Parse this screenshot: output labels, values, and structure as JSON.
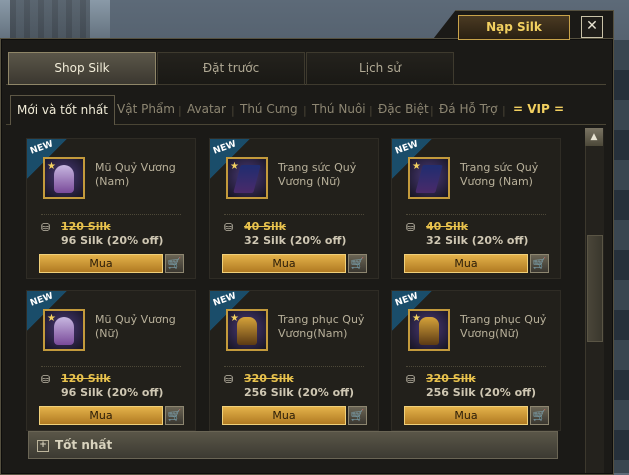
{
  "header": {
    "silk_button": "Nạp Silk",
    "close_glyph": "✕"
  },
  "top_tabs": [
    "Shop Silk",
    "Đặt trước",
    "Lịch sử"
  ],
  "category_tabs": [
    "Mới và tốt nhất",
    "Vật Phẩm",
    "Avatar",
    "Thú Cưng",
    "Thú Nuôi",
    "Đặc Biệt",
    "Đá Hỗ Trợ",
    "= VIP ="
  ],
  "items": [
    {
      "badge": "NEW",
      "name": "Mũ Quỷ Vương (Nam)",
      "old_price": "120 Silk",
      "price": "96 Silk (20% off)",
      "buy": "Mua"
    },
    {
      "badge": "NEW",
      "name": "Trang sức Quỷ Vương (Nữ)",
      "old_price": "40 Silk",
      "price": "32 Silk (20% off)",
      "buy": "Mua"
    },
    {
      "badge": "NEW",
      "name": "Trang sức Quỷ Vương (Nam)",
      "old_price": "40 Silk",
      "price": "32 Silk (20% off)",
      "buy": "Mua"
    },
    {
      "badge": "NEW",
      "name": "Mũ Quỷ Vương (Nữ)",
      "old_price": "120 Silk",
      "price": "96 Silk (20% off)",
      "buy": "Mua"
    },
    {
      "badge": "NEW",
      "name": "Trang phục Quỷ Vương(Nam)",
      "old_price": "320 Silk",
      "price": "256 Silk (20% off)",
      "buy": "Mua"
    },
    {
      "badge": "NEW",
      "name": "Trang phục Quỷ Vương(Nữ)",
      "old_price": "320 Silk",
      "price": "256 Silk (20% off)",
      "buy": "Mua"
    }
  ],
  "section": {
    "title": "Tốt nhất"
  },
  "icons": {
    "cart": "cart-icon",
    "coin": "coin-stack-icon",
    "close": "close-icon",
    "scroll_up": "scroll-up-arrow-icon",
    "expand": "plus-box-icon"
  },
  "colors": {
    "accent_gold": "#f2d060",
    "button_gold": "#e4b24a",
    "panel": "#1b1a17",
    "badge_blue": "#1a4d6a"
  }
}
